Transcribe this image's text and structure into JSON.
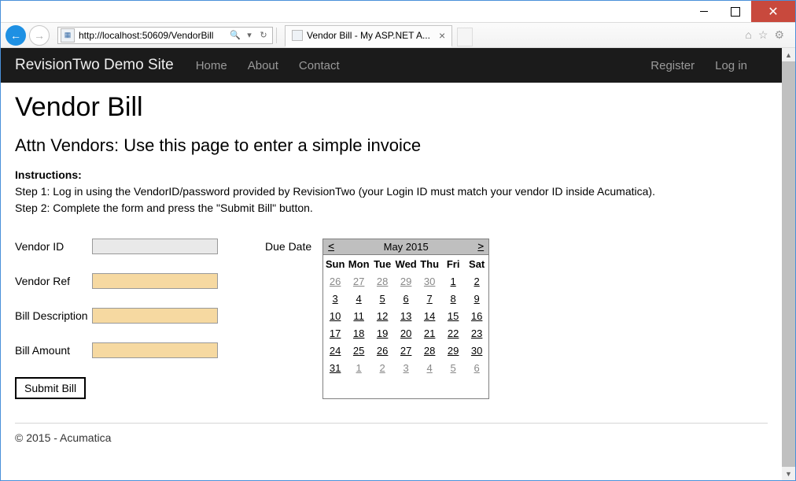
{
  "browser": {
    "url": "http://localhost:50609/VendorBill",
    "search_symbol": "➔",
    "search_icon": "🔍",
    "refresh_icon": "↻",
    "tab_title": "Vendor Bill - My ASP.NET A...",
    "tab_close": "×",
    "win_close": "✕",
    "tool_home": "⌂",
    "tool_fav": "☆",
    "tool_gear": "⚙"
  },
  "nav": {
    "brand": "RevisionTwo Demo Site",
    "links": [
      "Home",
      "About",
      "Contact"
    ],
    "right_links": [
      "Register",
      "Log in"
    ]
  },
  "page": {
    "h1": "Vendor Bill",
    "h2": "Attn Vendors: Use this page to enter a simple invoice",
    "instructions_label": "Instructions:",
    "step1": "Step 1: Log in using the VendorID/password provided by RevisionTwo (your Login ID must match your vendor ID inside Acumatica).",
    "step2": "Step 2: Complete the form and press the \"Submit Bill\" button.",
    "labels": {
      "vendor_id": "Vendor ID",
      "vendor_ref": "Vendor Ref",
      "bill_desc": "Bill Description",
      "bill_amount": "Bill Amount",
      "due_date": "Due Date"
    },
    "values": {
      "vendor_id": "",
      "vendor_ref": "",
      "bill_desc": "",
      "bill_amount": ""
    },
    "submit_label": "Submit Bill",
    "footer": "© 2015 - Acumatica"
  },
  "calendar": {
    "prev": "<",
    "next": ">",
    "title": "May 2015",
    "dow": [
      "Sun",
      "Mon",
      "Tue",
      "Wed",
      "Thu",
      "Fri",
      "Sat"
    ],
    "weeks": [
      [
        {
          "d": 26,
          "o": true
        },
        {
          "d": 27,
          "o": true
        },
        {
          "d": 28,
          "o": true
        },
        {
          "d": 29,
          "o": true
        },
        {
          "d": 30,
          "o": true
        },
        {
          "d": 1
        },
        {
          "d": 2
        }
      ],
      [
        {
          "d": 3
        },
        {
          "d": 4
        },
        {
          "d": 5
        },
        {
          "d": 6
        },
        {
          "d": 7
        },
        {
          "d": 8
        },
        {
          "d": 9
        }
      ],
      [
        {
          "d": 10
        },
        {
          "d": 11
        },
        {
          "d": 12
        },
        {
          "d": 13
        },
        {
          "d": 14
        },
        {
          "d": 15
        },
        {
          "d": 16
        }
      ],
      [
        {
          "d": 17
        },
        {
          "d": 18
        },
        {
          "d": 19
        },
        {
          "d": 20
        },
        {
          "d": 21
        },
        {
          "d": 22
        },
        {
          "d": 23
        }
      ],
      [
        {
          "d": 24
        },
        {
          "d": 25
        },
        {
          "d": 26
        },
        {
          "d": 27
        },
        {
          "d": 28
        },
        {
          "d": 29
        },
        {
          "d": 30
        }
      ],
      [
        {
          "d": 31
        },
        {
          "d": 1,
          "o": true
        },
        {
          "d": 2,
          "o": true
        },
        {
          "d": 3,
          "o": true
        },
        {
          "d": 4,
          "o": true
        },
        {
          "d": 5,
          "o": true
        },
        {
          "d": 6,
          "o": true
        }
      ]
    ]
  }
}
